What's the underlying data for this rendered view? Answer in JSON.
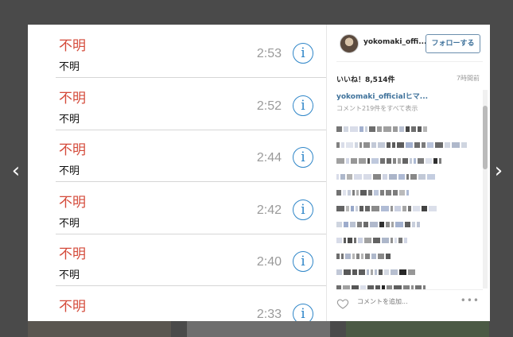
{
  "nav": {
    "prev_arrow": "‹",
    "next_arrow": "›"
  },
  "calls": [
    {
      "name": "不明",
      "label": "不明",
      "time": "2:53"
    },
    {
      "name": "不明",
      "label": "不明",
      "time": "2:52"
    },
    {
      "name": "不明",
      "label": "不明",
      "time": "2:44"
    },
    {
      "name": "不明",
      "label": "不明",
      "time": "2:42"
    },
    {
      "name": "不明",
      "label": "不明",
      "time": "2:40"
    },
    {
      "name": "不明",
      "label": "不明",
      "time": "2:33"
    }
  ],
  "info_glyph": "i",
  "post": {
    "username": "yokomaki_offi...",
    "follow_label": "フォローする",
    "likes": "いいね！8,514件",
    "time_ago": "7時間前",
    "caption_user": "yokomaki_officialヒマ...",
    "view_all_comments": "コメント219件をすべて表示",
    "comment_placeholder": "コメントを追加...",
    "more_label": "•••"
  },
  "colors": {
    "missed_call": "#d44a3a",
    "info_blue": "#2f86c8",
    "link_blue": "#3f729b"
  },
  "icons": {
    "like": "heart-outline-icon",
    "info": "info-circle-icon"
  }
}
